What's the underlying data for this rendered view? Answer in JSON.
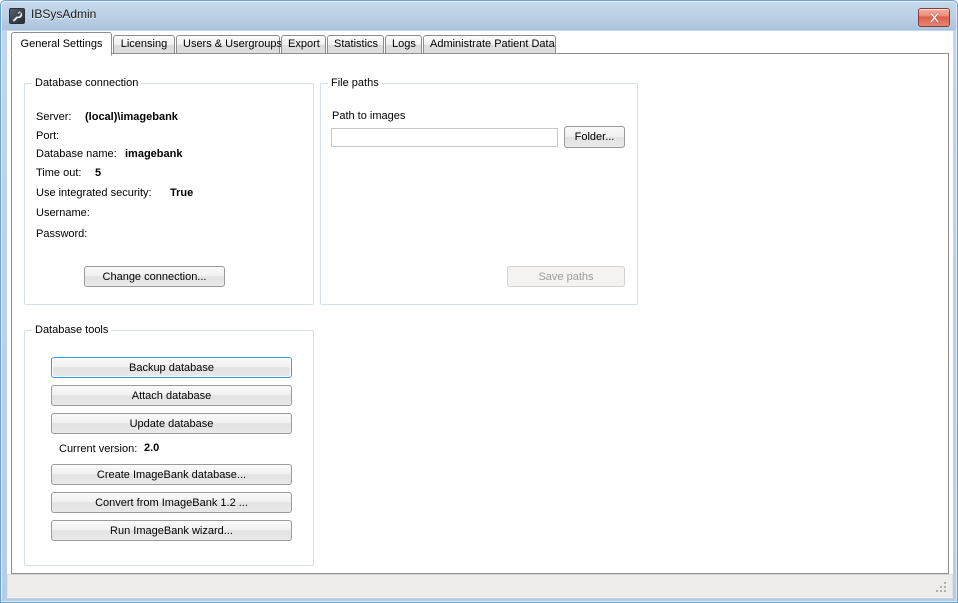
{
  "window": {
    "title": "IBSysAdmin",
    "icon": "wrench-icon",
    "close_label": "Close",
    "accent_focus_color": "#3c9ad9",
    "close_button_color": "#d9604c",
    "titlebar_color": "#bbd0e6"
  },
  "tabs": [
    {
      "label": "General Settings",
      "selected": true
    },
    {
      "label": "Licensing",
      "selected": false
    },
    {
      "label": "Users & Usergroups",
      "selected": false
    },
    {
      "label": "Export",
      "selected": false
    },
    {
      "label": "Statistics",
      "selected": false
    },
    {
      "label": "Logs",
      "selected": false
    },
    {
      "label": "Administrate Patient Data",
      "selected": false
    }
  ],
  "database_connection": {
    "group_title": "Database connection",
    "fields": [
      {
        "label": "Server:",
        "value": "(local)\\imagebank"
      },
      {
        "label": "Port:",
        "value": ""
      },
      {
        "label": "Database name:",
        "value": "imagebank"
      },
      {
        "label": "Time out:",
        "value": "5"
      },
      {
        "label": "Use integrated security:",
        "value": "True"
      },
      {
        "label": "Username:",
        "value": ""
      },
      {
        "label": "Password:",
        "value": ""
      }
    ],
    "change_connection_label": "Change connection..."
  },
  "file_paths": {
    "group_title": "File paths",
    "path_to_images_label": "Path to images",
    "path_to_images_value": "",
    "path_to_images_placeholder": "",
    "folder_button_label": "Folder...",
    "save_paths_label": "Save paths",
    "save_paths_enabled": false
  },
  "database_tools": {
    "group_title": "Database tools",
    "buttons_top": [
      {
        "label": "Backup database",
        "focused": true
      },
      {
        "label": "Attach database",
        "focused": false
      },
      {
        "label": "Update database",
        "focused": false
      }
    ],
    "current_version_label": "Current version:",
    "current_version_value": "2.0",
    "buttons_bottom": [
      {
        "label": "Create ImageBank database...",
        "focused": false
      },
      {
        "label": "Convert from ImageBank 1.2 ...",
        "focused": false
      },
      {
        "label": "Run ImageBank wizard...",
        "focused": false
      }
    ]
  },
  "statusbar": {
    "text": "",
    "grip": "resize-grip-icon"
  }
}
